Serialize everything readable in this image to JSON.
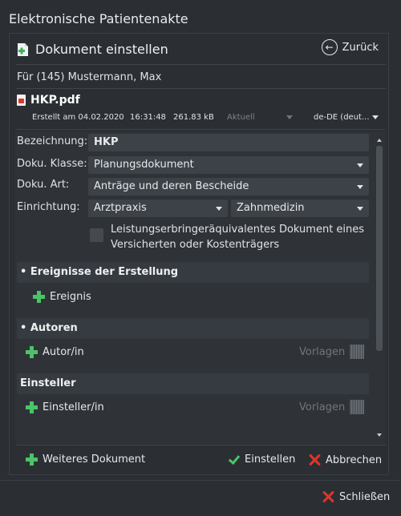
{
  "window": {
    "title": "Elektronische Patientenakte"
  },
  "header": {
    "title": "Dokument einstellen",
    "back_label": "Zurück"
  },
  "patient": {
    "label": "Für (145) Mustermann, Max"
  },
  "file": {
    "name": "HKP.pdf",
    "created": "Erstellt am 04.02.2020",
    "time": "16:31:48",
    "size": "261.83 kB",
    "status": "Aktuell",
    "language": "de-DE (deut..."
  },
  "form": {
    "bezeichnung_label": "Bezeichnung:",
    "bezeichnung_value": "HKP",
    "klasse_label": "Doku. Klasse:",
    "klasse_value": "Planungsdokument",
    "art_label": "Doku. Art:",
    "art_value": "Anträge und deren Bescheide",
    "einrichtung_label": "Einrichtung:",
    "einrichtung_value": "Arztpraxis",
    "fach_value": "Zahnmedizin",
    "checkbox_line1": "Leistungserbringeräquivalentes Dokument eines",
    "checkbox_line2": "Versicherten oder Kostenträgers",
    "checkbox_checked": false
  },
  "sections": {
    "ereignisse_title": "• Ereignisse der Erstellung",
    "ereignis_add": "Ereignis",
    "autoren_title": "• Autoren",
    "autor_add": "Autor/in",
    "autor_vorlagen": "Vorlagen",
    "einsteller_title": "Einsteller",
    "einsteller_add": "Einsteller/in",
    "einsteller_vorlagen": "Vorlagen"
  },
  "actions": {
    "weiteres": "Weiteres Dokument",
    "einstellen": "Einstellen",
    "abbrechen": "Abbrechen",
    "schliessen": "Schließen"
  },
  "colors": {
    "accent_green": "#4cc36a",
    "cancel_red": "#e0352b",
    "background": "#2b2f33"
  }
}
